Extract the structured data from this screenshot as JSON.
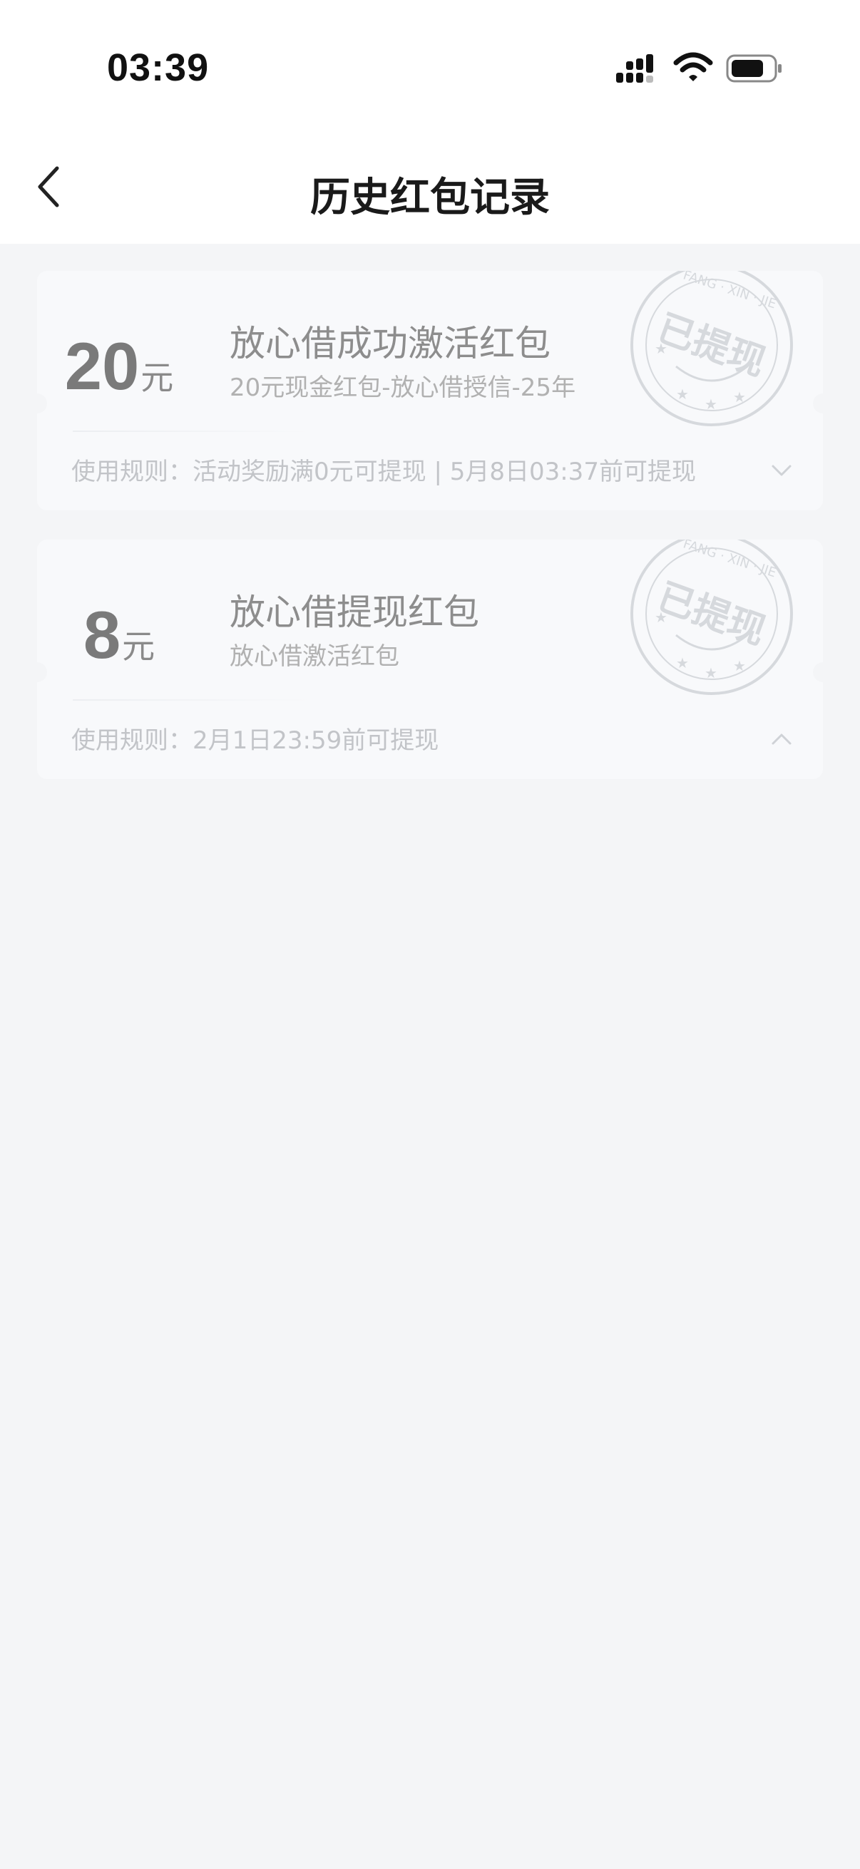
{
  "status_bar": {
    "time": "03:39"
  },
  "header": {
    "title": "历史红包记录"
  },
  "cards": [
    {
      "amount": "20",
      "unit": "元",
      "title": "放心借成功激活红包",
      "subtitle": "20元现金红包-放心借授信-25年",
      "rule": "使用规则：活动奖励满0元可提现 | 5月8日03:37前可提现",
      "stamp_text": "已提现",
      "stamp_ring": "FANG · XIN · JIE",
      "expanded": false
    },
    {
      "amount": "8",
      "unit": "元",
      "title": "放心借提现红包",
      "subtitle": "放心借激活红包",
      "rule": "使用规则：2月1日23:59前可提现",
      "stamp_text": "已提现",
      "stamp_ring": "FANG · XIN · JIE",
      "expanded": true
    }
  ]
}
